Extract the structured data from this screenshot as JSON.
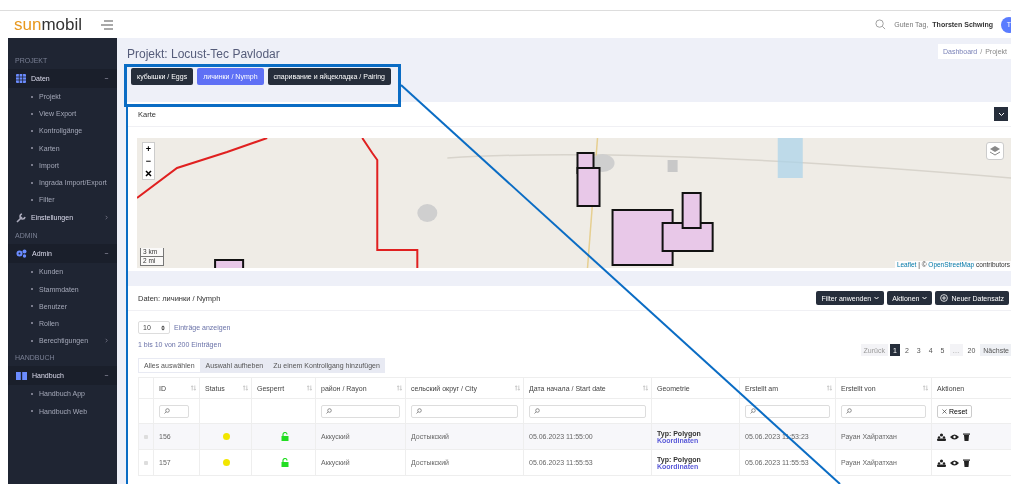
{
  "logo": {
    "part1": "sun",
    "part2": "mobil"
  },
  "topbar": {
    "greeting": "Guten Tag,",
    "user": "Thorsten Schwing",
    "avatar": "T"
  },
  "sidebar": [
    {
      "heading": "PROJEKT",
      "items": [
        {
          "label": "Daten",
          "expanded": true,
          "children": [
            {
              "label": "Projekt"
            },
            {
              "label": "View Export"
            },
            {
              "label": "Kontrollgänge"
            },
            {
              "label": "Karten"
            },
            {
              "label": "Import"
            },
            {
              "label": "Ingrada Import/Export"
            },
            {
              "label": "Filter"
            }
          ]
        },
        {
          "label": "Einstellungen",
          "expanded": false
        }
      ]
    },
    {
      "heading": "ADMIN",
      "items": [
        {
          "label": "Admin",
          "expanded": true,
          "children": [
            {
              "label": "Kunden"
            },
            {
              "label": "Stammdaten"
            },
            {
              "label": "Benutzer"
            },
            {
              "label": "Rollen"
            },
            {
              "label": "Berechtigungen",
              "expanded": false
            }
          ]
        }
      ]
    },
    {
      "heading": "HANDBUCH",
      "items": [
        {
          "label": "Handbuch",
          "expanded": true,
          "children": [
            {
              "label": "Handbuch App"
            },
            {
              "label": "Handbuch Web"
            }
          ]
        }
      ]
    }
  ],
  "page_title": "Projekt: Locust-Tec Pavlodar",
  "breadcrumb": [
    "Dashboard",
    "Projekt"
  ],
  "breadcrumb_separator": "/",
  "stage_tabs": [
    {
      "label": "кубышки / Eggs",
      "selected": false
    },
    {
      "label": "личинки / Nymph",
      "selected": true
    },
    {
      "label": "спаривание и яйцекладка / Pairing",
      "selected": false
    }
  ],
  "map_card": {
    "title": "Karte",
    "scale": [
      "3 km",
      "2 mi"
    ],
    "attribution_links": [
      "Leaflet",
      "OpenStreetMap"
    ],
    "attribution_sep": "| ©",
    "attribution_tail": "contributors",
    "zoom_in": "+",
    "zoom_out": "−"
  },
  "data_card": {
    "title_prefix": "Daten:",
    "title": "личинки / Nymph",
    "buttons": [
      {
        "label": "Filter anwenden",
        "kind": "dropdown"
      },
      {
        "label": "Aktionen",
        "kind": "dropdown"
      },
      {
        "label": "Neuer Datensatz",
        "kind": "add"
      }
    ],
    "page_size": "10",
    "page_size_label": "Einträge anzeigen",
    "info": "1 bis 10 von 200 Einträgen",
    "selection_buttons": [
      "Alles auswählen",
      "Auswahl aufheben",
      "Zu einem Kontrollgang hinzufügen"
    ],
    "pagination": [
      {
        "label": "Zurück",
        "selected": false,
        "disabled": true
      },
      {
        "label": "1",
        "selected": true,
        "disabled": false
      },
      {
        "label": "2",
        "selected": false,
        "disabled": false
      },
      {
        "label": "3",
        "selected": false,
        "disabled": false
      },
      {
        "label": "4",
        "selected": false,
        "disabled": false
      },
      {
        "label": "5",
        "selected": false,
        "disabled": false
      },
      {
        "label": "…",
        "selected": false,
        "disabled": true
      },
      {
        "label": "20",
        "selected": false,
        "disabled": false
      },
      {
        "label": "Nächste",
        "selected": false,
        "disabled": false
      }
    ],
    "columns": [
      {
        "label": "ID",
        "sortable": true,
        "filter": true
      },
      {
        "label": "Status",
        "sortable": true,
        "filter": false
      },
      {
        "label": "Gesperrt",
        "sortable": true,
        "filter": false
      },
      {
        "label": "район / Rayon",
        "sortable": true,
        "filter": true
      },
      {
        "label": "сельский округ / City",
        "sortable": true,
        "filter": true
      },
      {
        "label": "Дата начала / Start date",
        "sortable": true,
        "filter": true
      },
      {
        "label": "Geometrie",
        "sortable": false,
        "filter": false
      },
      {
        "label": "Erstellt am",
        "sortable": true,
        "filter": true
      },
      {
        "label": "Erstellt von",
        "sortable": true,
        "filter": true
      },
      {
        "label": "Aktionen",
        "sortable": false,
        "filter": false
      }
    ],
    "reset": "Reset",
    "rows": [
      {
        "id": "156",
        "checked": false,
        "color": "#f2e600",
        "locked": false,
        "rayon": "Аккуский",
        "city": "Достыкский",
        "start": "05.06.2023 11:55:00",
        "geo_type": "Typ: Polygon",
        "geo_link": "Koordinaten",
        "created": "05.06.2023 11:53:23",
        "author": "Рауан Хайратхан"
      },
      {
        "id": "157",
        "checked": false,
        "color": "#f2e600",
        "locked": false,
        "rayon": "Аккуский",
        "city": "Достыкский",
        "start": "05.06.2023 11:55:53",
        "geo_type": "Typ: Polygon",
        "geo_link": "Koordinaten",
        "created": "05.06.2023 11:55:53",
        "author": "Рауан Хайратхан"
      }
    ]
  }
}
